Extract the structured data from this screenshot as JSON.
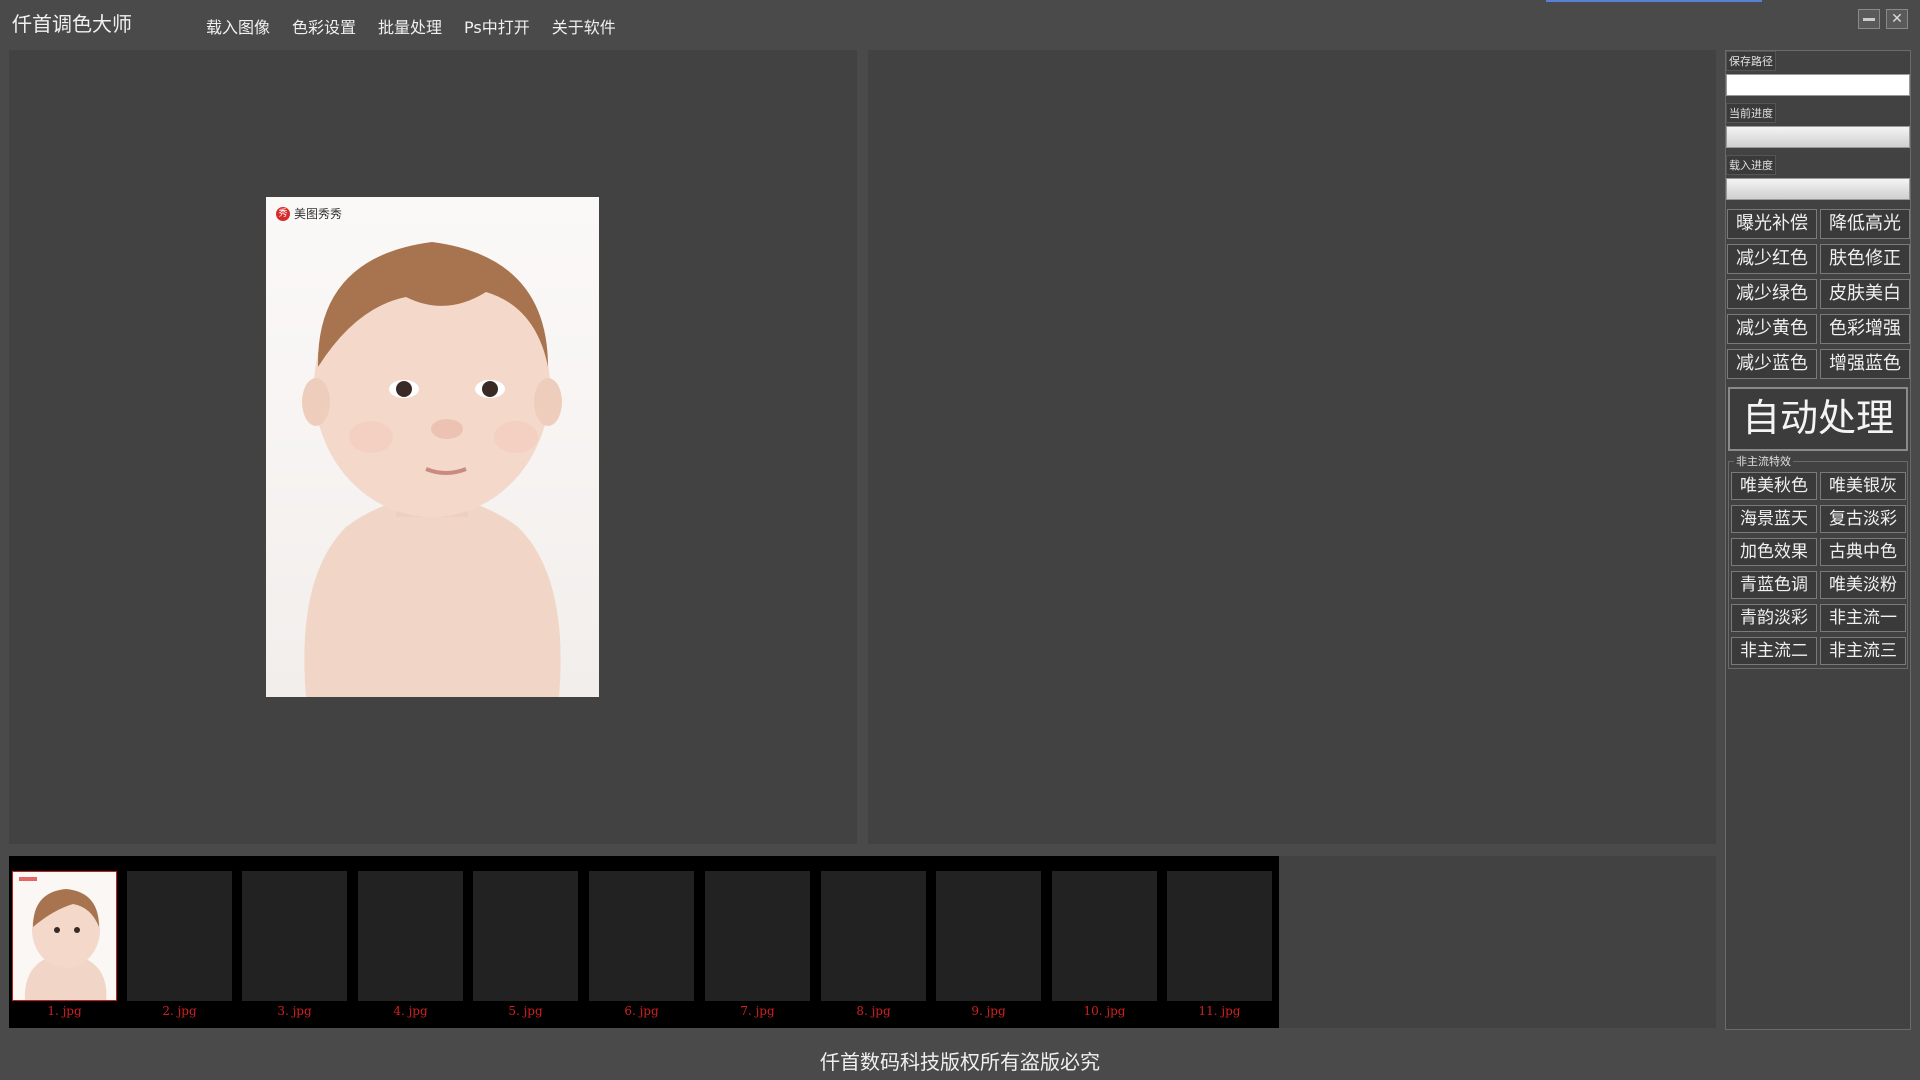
{
  "app": {
    "title": "仟首调色大师"
  },
  "menu": [
    "载入图像",
    "色彩设置",
    "批量处理",
    "Ps中打开",
    "关于软件"
  ],
  "preview": {
    "watermark": "美图秀秀",
    "watermark_badge": "秀"
  },
  "thumbnails": [
    "1. jpg",
    "2. jpg",
    "3. jpg",
    "4. jpg",
    "5. jpg",
    "6. jpg",
    "7. jpg",
    "8. jpg",
    "9. jpg",
    "10. jpg",
    "11. jpg"
  ],
  "side": {
    "save_path_label": "保存路径",
    "save_path_value": "",
    "current_progress_label": "当前进度",
    "load_progress_label": "载入进度",
    "adjust_buttons": [
      "曝光补偿",
      "降低高光",
      "减少红色",
      "肤色修正",
      "减少绿色",
      "皮肤美白",
      "减少黄色",
      "色彩增强",
      "减少蓝色",
      "增强蓝色"
    ],
    "auto_label": "自动处理",
    "group_title": "非主流特效",
    "effect_buttons": [
      "唯美秋色",
      "唯美银灰",
      "海景蓝天",
      "复古淡彩",
      "加色效果",
      "古典中色",
      "青蓝色调",
      "唯美淡粉",
      "青韵淡彩",
      "非主流一",
      "非主流二",
      "非主流三"
    ]
  },
  "footer": {
    "copyright": "仟首数码科技版权所有盗版必究"
  },
  "colors": {
    "background": "#4a4a4a",
    "panel": "#424242",
    "accent": "#5b7fd6",
    "thumb_label": "#d02020"
  }
}
